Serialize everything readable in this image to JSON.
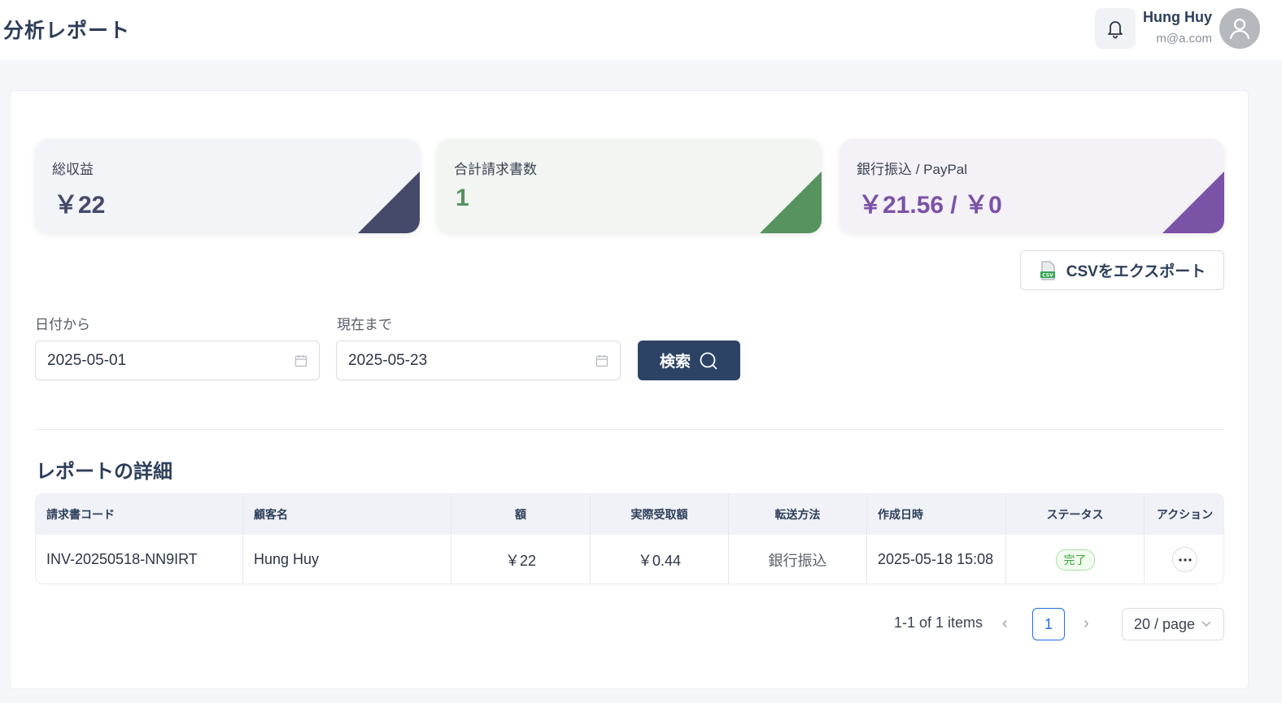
{
  "header": {
    "title": "分析レポート",
    "user_name": "Hung Huy",
    "user_email": "m@a.com"
  },
  "stats": [
    {
      "label": "総収益",
      "value": "￥22",
      "color": "#454a6b",
      "bg": "#f3f4f8"
    },
    {
      "label": "合計請求書数",
      "value": "1",
      "color": "#56935f",
      "bg": "#f2f5f2"
    },
    {
      "label": "銀行振込 / PayPal",
      "value": "￥21.56 / ￥0",
      "color": "#7a52a6",
      "bg": "#f4f1f7"
    }
  ],
  "export": {
    "label": "CSVをエクスポート"
  },
  "filters": {
    "from_label": "日付から",
    "from_value": "2025-05-01",
    "to_label": "現在まで",
    "to_value": "2025-05-23",
    "search_label": "検索"
  },
  "report": {
    "title": "レポートの詳細",
    "columns": [
      "請求書コード",
      "顧客名",
      "額",
      "実際受取額",
      "転送方法",
      "作成日時",
      "ステータス",
      "アクション"
    ],
    "rows": [
      {
        "code": "INV-20250518-NN9IRT",
        "customer": "Hung Huy",
        "amount": "￥22",
        "received": "￥0.44",
        "method": "銀行振込",
        "created": "2025-05-18 15:08",
        "status": "完了"
      }
    ]
  },
  "pagination": {
    "total_text": "1-1 of 1 items",
    "current_page": "1",
    "page_size": "20 / page"
  }
}
